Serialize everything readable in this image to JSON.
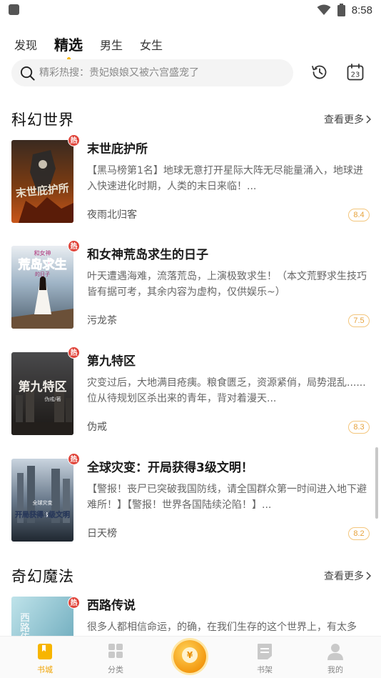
{
  "status_bar": {
    "time": "8:58"
  },
  "tabs": [
    {
      "label": "发现",
      "active": false
    },
    {
      "label": "精选",
      "active": true
    },
    {
      "label": "男生",
      "active": false
    },
    {
      "label": "女生",
      "active": false
    }
  ],
  "search": {
    "placeholder": "精彩热搜：贵妃娘娘又被六宫盛宠了"
  },
  "calendar_day": "23",
  "sections": [
    {
      "title": "科幻世界",
      "more_label": "查看更多",
      "books": [
        {
          "title": "末世庇护所",
          "hot_label": "热",
          "desc": "【黑马榜第1名】地球无意打开星际大阵无尽能量涌入，地球进入快速进化时期，人类的末日来临！...",
          "author": "夜雨北归客",
          "score": "8.4"
        },
        {
          "title": "和女神荒岛求生的日子",
          "hot_label": "热",
          "desc": "叶天遭遇海难，流落荒岛，上演极致求生！（本文荒野求生技巧皆有据可考，其余内容为虚构，仅供娱乐~）",
          "author": "污龙茶",
          "score": "7.5"
        },
        {
          "title": "第九特区",
          "hot_label": "热",
          "desc": "灾变过后，大地满目疮痍。粮食匮乏，资源紧俏，局势混乱...... 位从待规划区杀出来的青年，背对着漫天...",
          "author": "伪戒",
          "score": "8.3"
        },
        {
          "title": "全球灾变：开局获得3级文明！",
          "hot_label": "热",
          "desc": "【警报！丧尸已突破我国防线，请全国群众第一时间进入地下避难所！】【警报！世界各国陆续沦陷！】...",
          "author": "日天榜",
          "score": "8.2"
        }
      ]
    },
    {
      "title": "奇幻魔法",
      "more_label": "查看更多",
      "books": [
        {
          "title": "西路传说",
          "hot_label": "热",
          "desc": "很多人都相信命运，的确，在我们生存的这个世界上，有太多",
          "author": "",
          "score": ""
        }
      ]
    }
  ],
  "covers": {
    "b1": {
      "text": "末世庇护所"
    },
    "b2": {
      "text": "荒岛求生",
      "sub": "和女神",
      "sub2": "的日子"
    },
    "b3": {
      "text": "第九特区",
      "sub": "伪戒/著"
    },
    "b4": {
      "text": "开局获得3级文明",
      "sub": "全球灾变"
    },
    "b5": {
      "text": "西路传"
    }
  },
  "bottom_nav": [
    {
      "label": "书城",
      "active": true
    },
    {
      "label": "分类",
      "active": false
    },
    {
      "label": "书架",
      "active": false
    },
    {
      "label": "我的",
      "active": false
    }
  ],
  "coin_symbol": "¥",
  "colors": {
    "accent": "#f7b500",
    "hot_badge": "#e0443a",
    "score": "#e6a23c"
  }
}
